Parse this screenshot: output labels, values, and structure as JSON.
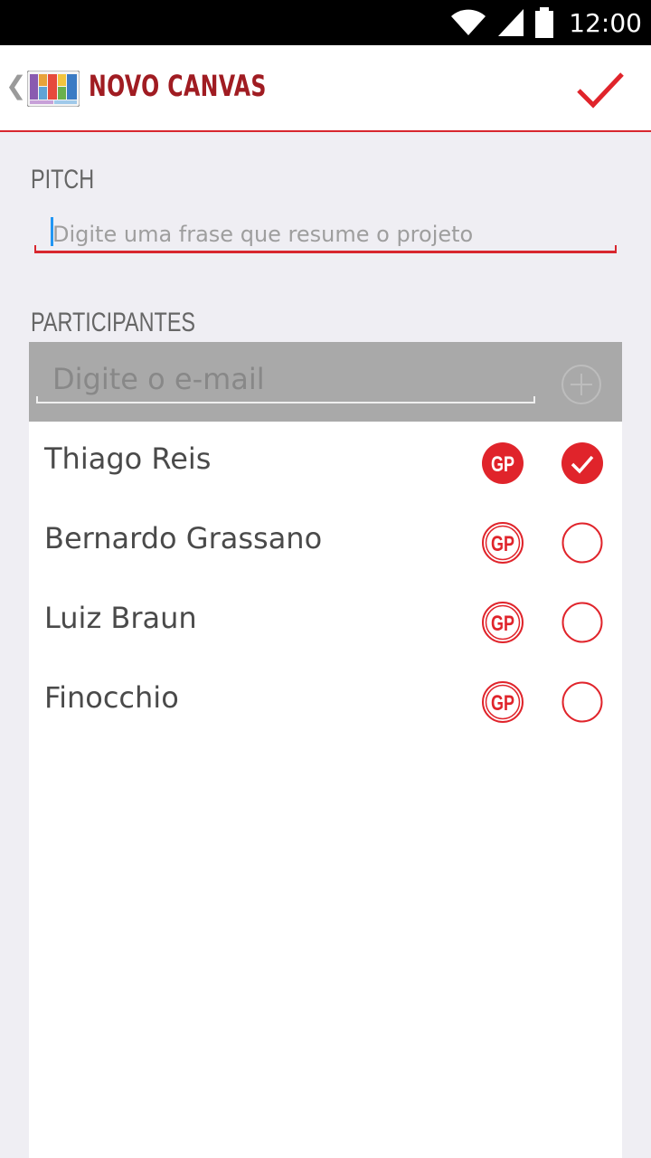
{
  "status_bar": {
    "time": "12:00",
    "icons": [
      "wifi-icon",
      "signal-icon",
      "battery-icon"
    ]
  },
  "action_bar": {
    "back_icon": "chevron-left-icon",
    "logo_icon": "canvas-grid-logo-icon",
    "title": "NOVO CANVAS",
    "confirm_icon": "checkmark-icon"
  },
  "pitch": {
    "label": "PITCH",
    "placeholder": "Digite uma frase que resume o projeto",
    "value": ""
  },
  "participants": {
    "label": "PARTICIPANTES",
    "email_placeholder": "Digite o e-mail",
    "add_icon": "add-circle-icon",
    "items": [
      {
        "name": "Thiago Reis",
        "gp_badge": "GP",
        "gp_active": true,
        "selected": true
      },
      {
        "name": "Bernardo Grassano",
        "gp_badge": "GP",
        "gp_active": false,
        "selected": false
      },
      {
        "name": "Luiz Braun",
        "gp_badge": "GP",
        "gp_active": false,
        "selected": false
      },
      {
        "name": "Finocchio",
        "gp_badge": "GP",
        "gp_active": false,
        "selected": false
      }
    ]
  },
  "colors": {
    "accent": "#e0242b",
    "title": "#a01c22",
    "background": "#efeef3",
    "email_bar": "#a9a9a9"
  }
}
